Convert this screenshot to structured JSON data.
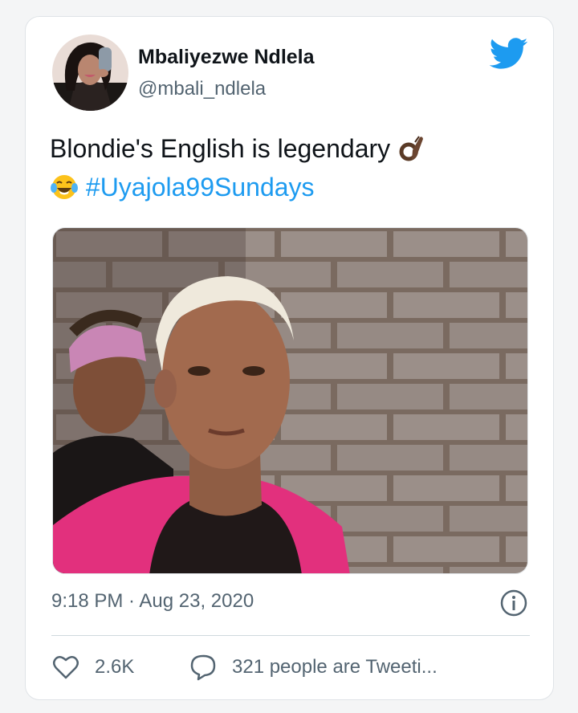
{
  "tweet": {
    "author_name": "Mbaliyezwe Ndlela",
    "author_handle": "@mbali_ndlela",
    "text_line1": "Blondie's English is legendary",
    "text_emoji1": "ok-hand-emoji",
    "text_emoji2": "tears-of-joy-emoji",
    "hashtag": "#Uyajola99Sundays",
    "timestamp": "9:18 PM · Aug 23, 2020",
    "likes_count": "2.6K",
    "people_tweeting": "321 people are Tweeti..."
  },
  "icons": {
    "brand": "twitter-bird-icon",
    "info": "info-icon",
    "like": "heart-icon",
    "reply": "speech-bubble-icon"
  },
  "colors": {
    "brand_blue": "#1d9bf0",
    "text_primary": "#0f1419",
    "text_secondary": "#536471",
    "border": "#dfe3e7"
  }
}
